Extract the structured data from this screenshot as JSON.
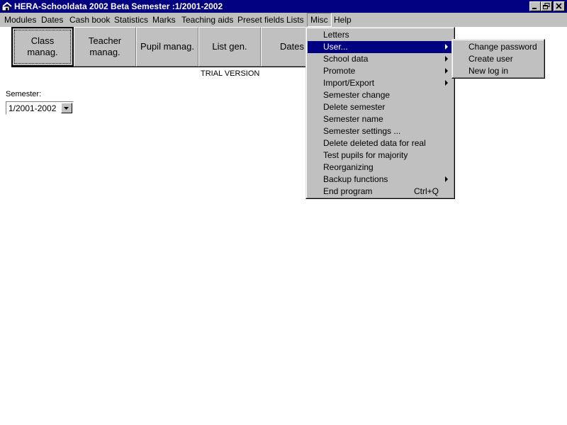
{
  "titlebar": {
    "title": "HERA-Schooldata 2002 Beta Semester :1/2001-2002"
  },
  "menubar": {
    "items": [
      {
        "label": "Modules"
      },
      {
        "label": "Dates"
      },
      {
        "label": "Cash book"
      },
      {
        "label": "Statistics"
      },
      {
        "label": "Marks"
      },
      {
        "label": "Teaching aids"
      },
      {
        "label": "Preset fields"
      },
      {
        "label": "Lists"
      },
      {
        "label": "Misc"
      },
      {
        "label": "Help"
      }
    ]
  },
  "toolbar": {
    "buttons": [
      {
        "line1": "Class",
        "line2": "manag."
      },
      {
        "line1": "Teacher",
        "line2": "manag."
      },
      {
        "line1": "Pupil manag.",
        "line2": ""
      },
      {
        "line1": "List gen.",
        "line2": ""
      },
      {
        "line1": "Dates",
        "line2": ""
      }
    ]
  },
  "trial_text": "TRIAL VERSION",
  "semester": {
    "label": "Semester:",
    "value": "1/2001-2002"
  },
  "misc_menu": {
    "items": [
      {
        "label": "Letters",
        "submenu": false,
        "shortcut": ""
      },
      {
        "label": "User...",
        "submenu": true,
        "shortcut": ""
      },
      {
        "label": "School data",
        "submenu": true,
        "shortcut": ""
      },
      {
        "label": "Promote",
        "submenu": true,
        "shortcut": ""
      },
      {
        "label": "Import/Export",
        "submenu": true,
        "shortcut": ""
      },
      {
        "label": "Semester change",
        "submenu": false,
        "shortcut": ""
      },
      {
        "label": "Delete semester",
        "submenu": false,
        "shortcut": ""
      },
      {
        "label": "Semester name",
        "submenu": false,
        "shortcut": ""
      },
      {
        "label": "Semester settings ...",
        "submenu": false,
        "shortcut": ""
      },
      {
        "label": "Delete deleted data for real",
        "submenu": false,
        "shortcut": ""
      },
      {
        "label": "Test pupils for majority",
        "submenu": false,
        "shortcut": ""
      },
      {
        "label": "Reorganizing",
        "submenu": false,
        "shortcut": ""
      },
      {
        "label": "Backup functions",
        "submenu": true,
        "shortcut": ""
      },
      {
        "label": "End program",
        "submenu": false,
        "shortcut": "Ctrl+Q"
      }
    ]
  },
  "user_menu": {
    "items": [
      {
        "label": "Change password"
      },
      {
        "label": "Create user"
      },
      {
        "label": "New log in"
      }
    ]
  },
  "colors": {
    "titlebar_bg": "#000080",
    "face": "#c0c0c0",
    "highlight": "#000080"
  }
}
